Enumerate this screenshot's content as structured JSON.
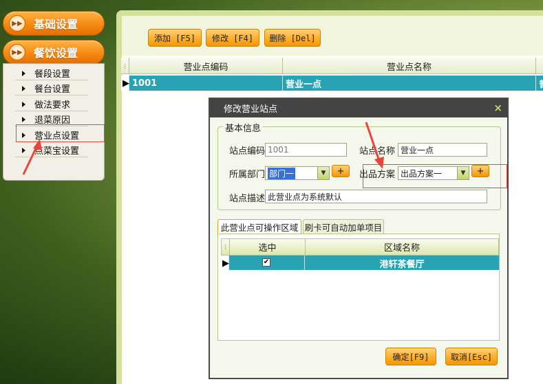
{
  "nav": {
    "section1": "基础设置",
    "section2": "餐饮设置",
    "items": [
      {
        "label": "餐段设置"
      },
      {
        "label": "餐台设置"
      },
      {
        "label": "做法要求"
      },
      {
        "label": "退菜原因"
      },
      {
        "label": "营业点设置"
      },
      {
        "label": "点菜宝设置"
      }
    ]
  },
  "toolbar": {
    "add": "添加 [F5]",
    "edit": "修改 [F4]",
    "delete": "删除 [Del]"
  },
  "grid": {
    "columns": [
      "营业点编码",
      "营业点名称"
    ],
    "rows": [
      {
        "code": "1001",
        "name": "营业一点",
        "extra": "普"
      }
    ]
  },
  "dialog": {
    "title": "修改营业站点",
    "close": "×",
    "legend": "基本信息",
    "labels": {
      "code": "站点编码",
      "name": "站点名称",
      "dept": "所属部门",
      "plan": "出品方案",
      "desc": "站点描述"
    },
    "values": {
      "code": "1001",
      "name": "营业一点",
      "dept": "部门一",
      "plan": "出品方案一",
      "desc": "此营业点为系统默认"
    },
    "plus": "+",
    "tabs": [
      "此营业点可操作区域",
      "刷卡可自动加单项目"
    ],
    "area_grid": {
      "columns": [
        "选中",
        "区域名称"
      ],
      "rows": [
        {
          "checked": true,
          "checkmark": "✔",
          "area": "港轩茶餐厅"
        }
      ]
    },
    "ok": "确定[F9]",
    "cancel": "取消[Esc]"
  },
  "colors": {
    "accent_orange": "#f58a11",
    "row_selected": "#29a3b3",
    "highlight_red": "#e8463c"
  }
}
